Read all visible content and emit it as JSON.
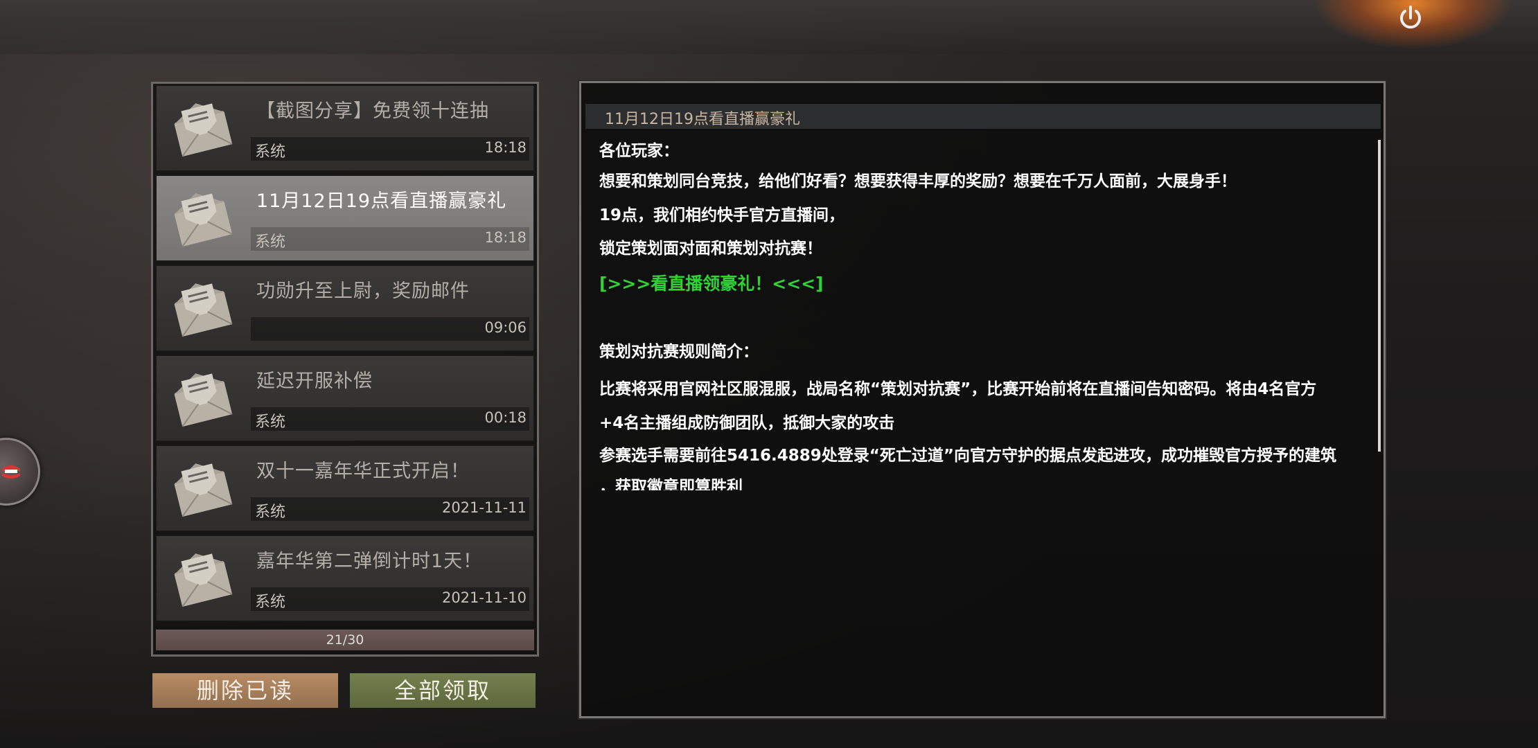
{
  "mail_list": {
    "items": [
      {
        "title": "【截图分享】免费领十连抽",
        "sender": "系统",
        "date": "18:18",
        "selected": false
      },
      {
        "title": "11月12日19点看直播赢豪礼",
        "sender": "系统",
        "date": "18:18",
        "selected": true
      },
      {
        "title": "功勋升至上尉，奖励邮件",
        "sender": "",
        "date": "09:06",
        "selected": false
      },
      {
        "title": "延迟开服补偿",
        "sender": "系统",
        "date": "00:18",
        "selected": false
      },
      {
        "title": "双十一嘉年华正式开启！",
        "sender": "系统",
        "date": "2021-11-11",
        "selected": false
      },
      {
        "title": "嘉年华第二弹倒计时1天！",
        "sender": "系统",
        "date": "2021-11-10",
        "selected": false
      }
    ],
    "page": "21/30"
  },
  "buttons": {
    "delete_read": "删除已读",
    "claim_all": "全部领取"
  },
  "content": {
    "title": "11月12日19点看直播赢豪礼",
    "lines": [
      "各位玩家：",
      "想要和策划同台竞技，给他们好看？想要获得丰厚的奖励？想要在千万人面前，大展身手！",
      "19点，我们相约快手官方直播间，",
      "锁定策划面对面和策划对抗赛！",
      "[>>>看直播领豪礼！<<<]",
      "",
      "策划对抗赛规则简介：",
      "比赛将采用官网社区服混服，战局名称“策划对抗赛”，比赛开始前将在直播间告知密码。将由4名官方",
      "+4名主播组成防御团队，抵御大家的攻击",
      "参赛选手需要前往5416.4889处登录“死亡过道”向官方守护的据点发起进攻，成功摧毁官方授予的建筑",
      "，获取徽章即算胜利"
    ],
    "link_color": "#2fd334"
  },
  "icons": {
    "power": "power-icon",
    "mail": "envelope-icon",
    "side": "mouth-icon"
  }
}
